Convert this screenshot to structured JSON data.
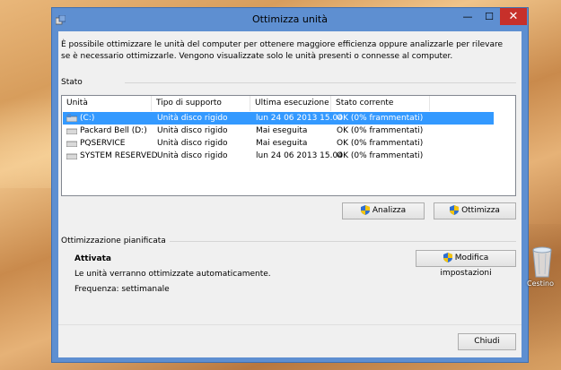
{
  "window": {
    "title": "Ottimizza unità",
    "controls": {
      "minimize": "—",
      "maximize": "☐",
      "close": "✕"
    }
  },
  "intro_text": "È possibile ottimizzare le unità del computer per ottenere maggiore efficienza oppure analizzarle per rilevare se è necessario ottimizzarle. Vengono visualizzate solo le unità presenti o connesse al computer.",
  "status_section": {
    "label": "Stato",
    "columns": [
      "Unità",
      "Tipo di supporto",
      "Ultima esecuzione",
      "Stato corrente"
    ],
    "rows": [
      {
        "drive": "(C:)",
        "media": "Unità disco rigido",
        "last_run": "lun 24 06 2013 15.04",
        "status": "OK (0% frammentati)",
        "selected": true
      },
      {
        "drive": "Packard Bell (D:)",
        "media": "Unità disco rigido",
        "last_run": "Mai eseguita",
        "status": "OK (0% frammentati)"
      },
      {
        "drive": "PQSERVICE",
        "media": "Unità disco rigido",
        "last_run": "Mai eseguita",
        "status": "OK (0% frammentati)"
      },
      {
        "drive": "SYSTEM RESERVED",
        "media": "Unità disco rigido",
        "last_run": "lun 24 06 2013 15.04",
        "status": "OK (0% frammentati)"
      }
    ]
  },
  "buttons": {
    "analyze": "Analizza",
    "optimize": "Ottimizza",
    "change_settings": "Modifica impostazioni",
    "close": "Chiudi"
  },
  "scheduled": {
    "label": "Ottimizzazione pianificata",
    "state": "Attivata",
    "description": "Le unità verranno ottimizzate automaticamente.",
    "frequency": "Frequenza: settimanale"
  },
  "desktop": {
    "recycle_bin_label": "Cestino"
  },
  "colors": {
    "titlebar": "#5e8fd1",
    "close_button": "#c7302a",
    "selection": "#3399ff"
  }
}
